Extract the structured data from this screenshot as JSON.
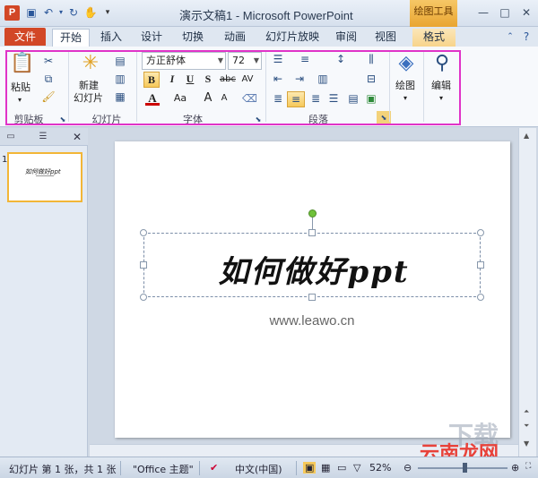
{
  "titlebar": {
    "app_icon": "P",
    "title": "演示文稿1 - Microsoft PowerPoint",
    "context_tools": "绘图工具",
    "quick_access": [
      "save-icon",
      "undo-icon",
      "redo-icon",
      "touch-icon",
      "customize-icon"
    ],
    "window_buttons": {
      "minimize": "—",
      "restore": "□",
      "close": "✕"
    }
  },
  "tabs": {
    "file": "文件",
    "items": [
      "开始",
      "插入",
      "设计",
      "切换",
      "动画",
      "幻灯片放映",
      "审阅",
      "视图",
      "格式"
    ],
    "active": "开始"
  },
  "ribbon": {
    "clipboard": {
      "label": "剪贴板",
      "paste": "粘贴"
    },
    "slides": {
      "label": "幻灯片",
      "new_slide_1": "新建",
      "new_slide_2": "幻灯片"
    },
    "font": {
      "label": "字体",
      "font_name": "方正舒体",
      "font_size": "72",
      "bold": "B",
      "italic": "I",
      "underline": "U",
      "strike": "S",
      "abc": "abc",
      "spacing": "AV",
      "color": "A",
      "case": "Aa",
      "grow": "A",
      "shrink": "A"
    },
    "paragraph": {
      "label": "段落"
    },
    "drawing": {
      "label": "绘图"
    },
    "editing": {
      "label": "编辑"
    }
  },
  "thumbnails": {
    "slide_number": "1",
    "thumb_title": "如何做好ppt"
  },
  "slide": {
    "title": "如何做好ppt",
    "subtitle": "www.leawo.cn"
  },
  "watermark": {
    "text": "云南龙网",
    "ghost": "下载"
  },
  "statusbar": {
    "slide_info": "幻灯片 第 1 张，共 1 张",
    "theme": "\"Office 主题\"",
    "language": "中文(中国)",
    "zoom": "52%",
    "zoom_fraction": 0.52
  },
  "colors": {
    "file_tab": "#d24726",
    "context_tools": "#f0b040",
    "highlight_border": "#e033c8"
  }
}
